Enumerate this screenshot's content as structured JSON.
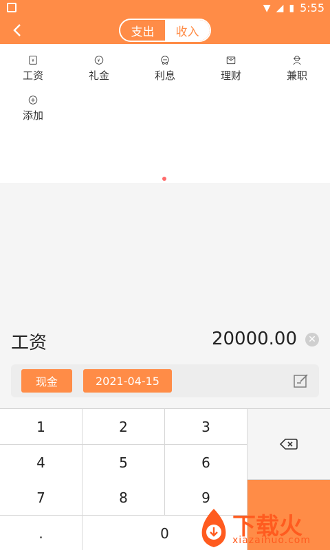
{
  "status_bar": {
    "time": "5:55"
  },
  "header": {
    "tabs": [
      {
        "label": "支出",
        "active": false
      },
      {
        "label": "收入",
        "active": true
      }
    ]
  },
  "categories": [
    {
      "label": "工资",
      "icon": "salary-icon"
    },
    {
      "label": "礼金",
      "icon": "gift-money-icon"
    },
    {
      "label": "利息",
      "icon": "interest-icon"
    },
    {
      "label": "理财",
      "icon": "finance-icon"
    },
    {
      "label": "兼职",
      "icon": "part-time-icon"
    },
    {
      "label": "添加",
      "icon": "add-icon"
    }
  ],
  "entry": {
    "category": "工资",
    "amount": "20000.00",
    "account": "现金",
    "date": "2021-04-15"
  },
  "keypad": {
    "keys": [
      "1",
      "2",
      "3",
      "4",
      "5",
      "6",
      "7",
      "8",
      "9",
      ".",
      "0"
    ]
  },
  "watermark": {
    "title": "下载火",
    "site": "xiazaihuo.com"
  },
  "colors": {
    "accent": "#ff8c47",
    "indicator": "#ff6b6b"
  }
}
